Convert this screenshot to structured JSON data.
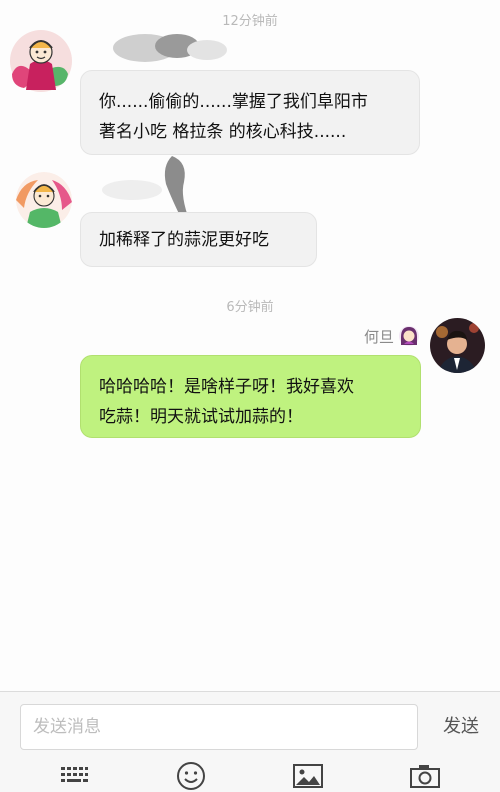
{
  "timestamps": {
    "first": "12分钟前",
    "second": "6分钟前"
  },
  "messages": {
    "incoming_1": {
      "line1": "你......偷偷的......掌握了我们阜阳市",
      "line2": "著名小吃 格拉条 的核心科技......"
    },
    "incoming_2": {
      "line1": "加稀释了的蒜泥更好吃"
    },
    "outgoing_1": {
      "sender_name": "何旦",
      "line1": "哈哈哈哈！是啥样子呀！我好喜欢",
      "line2": "吃蒜！明天就试试加蒜的！"
    }
  },
  "composer": {
    "placeholder": "发送消息",
    "send_label": "发送"
  },
  "toolbar": {
    "icons": [
      "keyboard-icon",
      "emoji-icon",
      "image-icon",
      "camera-icon"
    ]
  },
  "colors": {
    "outgoing_bubble": "#bff27f",
    "incoming_bubble": "#f2f2f2",
    "timestamp_text": "#b9b9b9"
  }
}
